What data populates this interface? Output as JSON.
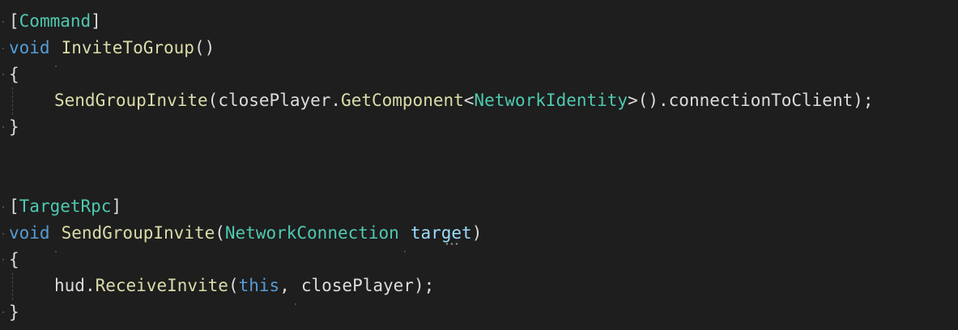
{
  "code": {
    "method1": {
      "attribute": "Command",
      "return_type": "void",
      "name": "InviteToGroup",
      "parens": "()",
      "open_brace": "{",
      "body_call": "SendGroupInvite",
      "body_arg_object": "closePlayer",
      "body_arg_method": "GetComponent",
      "body_arg_type": "NetworkIdentity",
      "body_arg_member": "connectionToClient",
      "close_brace": "}"
    },
    "method2": {
      "attribute": "TargetRpc",
      "return_type": "void",
      "name": "SendGroupInvite",
      "param_type": "NetworkConnection",
      "param_name": "target",
      "open_brace": "{",
      "body_object": "hud",
      "body_method": "ReceiveInvite",
      "body_arg1": "this",
      "body_arg2": "closePlayer",
      "close_brace": "}"
    }
  },
  "colors": {
    "background": "#1e1e1e",
    "keyword": "#569cd6",
    "type": "#4ec9b0",
    "method": "#dcdcaa",
    "parameter": "#9cdcfe",
    "plain": "#dcdcdc"
  }
}
